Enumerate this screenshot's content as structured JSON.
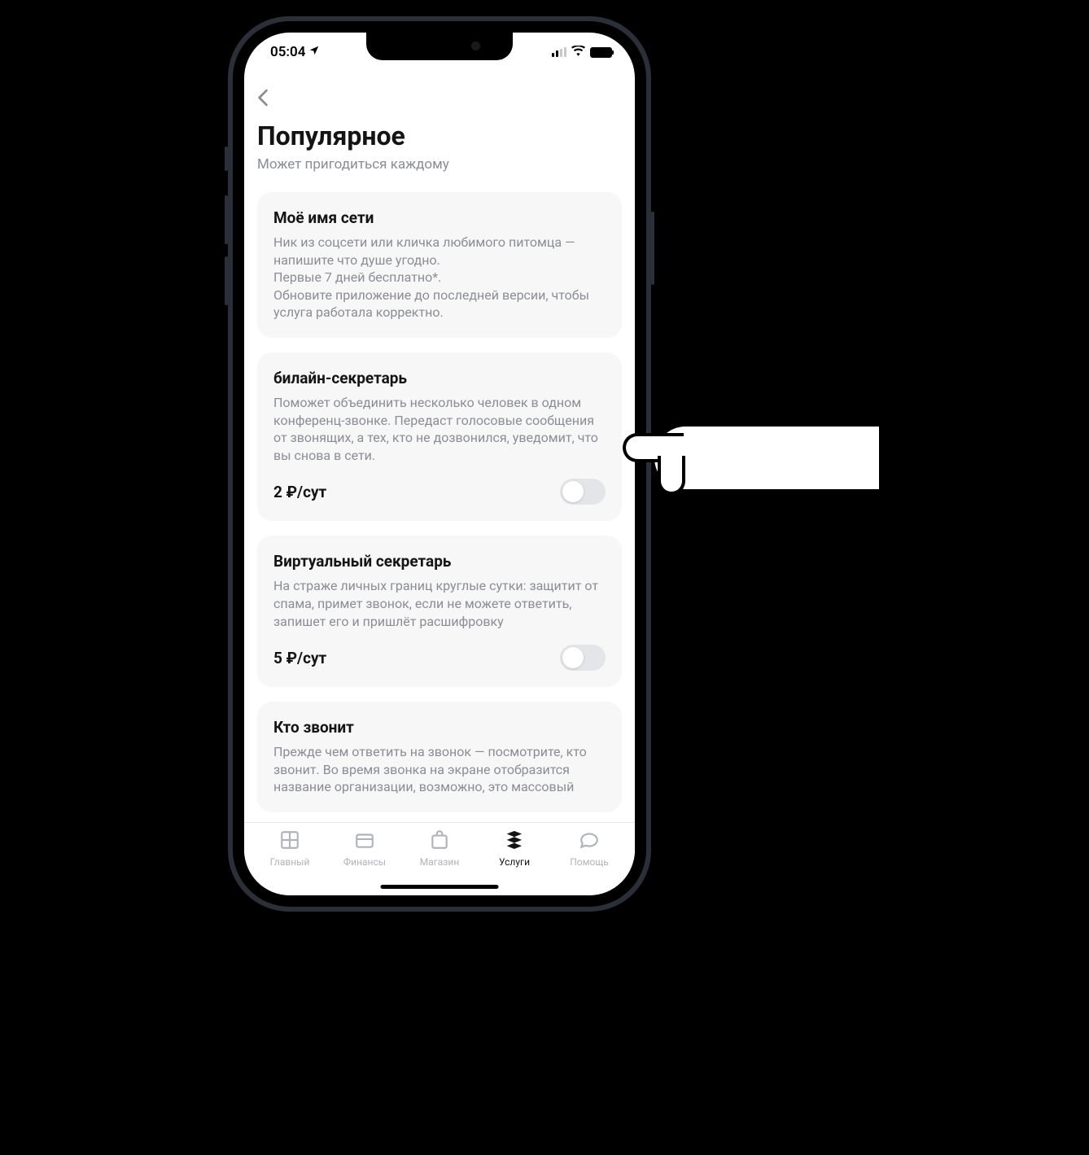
{
  "status_bar": {
    "time": "05:04"
  },
  "header": {
    "title": "Популярное",
    "subtitle": "Может пригодиться каждому"
  },
  "cards": [
    {
      "title": "Моё имя сети",
      "description": "Ник из соцсети или кличка любимого питомца — напишите что душе угодно.\nПервые 7 дней бесплатно*.\nОбновите приложение до последней версии, чтобы услуга работала корректно.",
      "price": "",
      "has_toggle": false,
      "toggle_on": false
    },
    {
      "title": "билайн-секретарь",
      "description": "Поможет объединить несколько человек в одном конференц-звонке. Передаст голосовые сообщения от звонящих, а тех, кто не дозвонился, уведомит, что вы снова в сети.",
      "price": "2 ₽/сут",
      "has_toggle": true,
      "toggle_on": false
    },
    {
      "title": "Виртуальный секретарь",
      "description": "На страже личных границ круглые сутки: защитит от спама, примет звонок, если не можете ответить, запишет его и пришлёт расшифровку",
      "price": "5 ₽/сут",
      "has_toggle": true,
      "toggle_on": false
    },
    {
      "title": "Кто звонит",
      "description": "Прежде чем ответить на звонок — посмотрите, кто звонит. Во время звонка на экране отобразится название организации, возможно, это массовый",
      "price": "",
      "has_toggle": false,
      "toggle_on": false
    }
  ],
  "tabs": [
    {
      "label": "Главный",
      "active": false
    },
    {
      "label": "Финансы",
      "active": false
    },
    {
      "label": "Магазин",
      "active": false
    },
    {
      "label": "Услуги",
      "active": true
    },
    {
      "label": "Помощь",
      "active": false
    }
  ]
}
